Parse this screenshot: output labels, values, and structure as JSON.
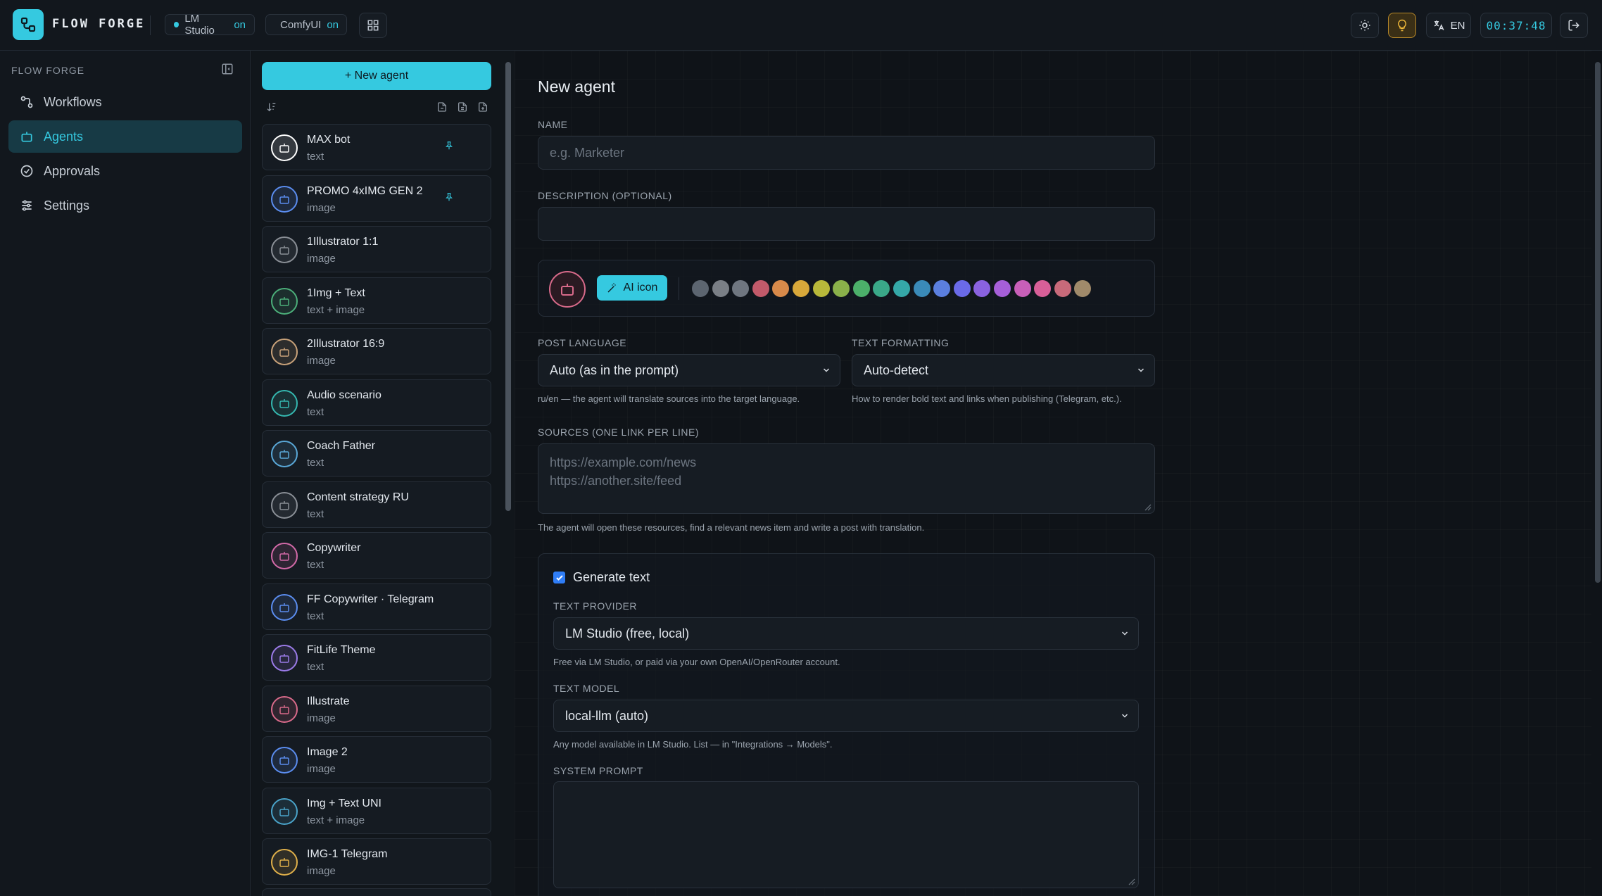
{
  "header": {
    "brand": "FLOW FORGE",
    "status": [
      {
        "name": "LM Studio",
        "state": "on"
      },
      {
        "name": "ComfyUI",
        "state": "on"
      }
    ],
    "language": "EN",
    "timer": "00:37:48"
  },
  "sidebar": {
    "title": "FLOW FORGE",
    "items": [
      {
        "label": "Workflows",
        "icon": "workflow-icon"
      },
      {
        "label": "Agents",
        "icon": "bot-icon",
        "active": true
      },
      {
        "label": "Approvals",
        "icon": "check-circle-icon"
      },
      {
        "label": "Settings",
        "icon": "sliders-icon"
      }
    ]
  },
  "agents": {
    "new_label": "+ New agent",
    "list": [
      {
        "name": "MAX bot",
        "type": "text",
        "color": "#ffffff",
        "pinned": true
      },
      {
        "name": "PROMO 4xIMG GEN 2",
        "type": "image",
        "color": "#5b8def",
        "pinned": true
      },
      {
        "name": "1Illustrator 1:1",
        "type": "image",
        "color": "#8a8f96"
      },
      {
        "name": "1Img + Text",
        "type": "text + image",
        "color": "#4caf7a"
      },
      {
        "name": "2Illustrator 16:9",
        "type": "image",
        "color": "#c9a27a"
      },
      {
        "name": "Audio scenario",
        "type": "text",
        "color": "#35b8b0"
      },
      {
        "name": "Coach Father",
        "type": "text",
        "color": "#5aa8d8"
      },
      {
        "name": "Content strategy RU",
        "type": "text",
        "color": "#8a8f96"
      },
      {
        "name": "Copywriter",
        "type": "text",
        "color": "#d36aa8"
      },
      {
        "name": "FF Copywriter · Telegram",
        "type": "text",
        "color": "#5b8def"
      },
      {
        "name": "FitLife Theme",
        "type": "text",
        "color": "#9b7be8"
      },
      {
        "name": "Illustrate",
        "type": "image",
        "color": "#d86a8a"
      },
      {
        "name": "Image 2",
        "type": "image",
        "color": "#5b8def"
      },
      {
        "name": "Img + Text UNI",
        "type": "text + image",
        "color": "#4aa3c9"
      },
      {
        "name": "IMG-1 Telegram",
        "type": "image",
        "color": "#e0b04a"
      }
    ]
  },
  "form": {
    "title": "New agent",
    "name_label": "NAME",
    "name_placeholder": "e.g. Marketer",
    "desc_label": "DESCRIPTION (OPTIONAL)",
    "ai_icon_label": "AI icon",
    "swatches": [
      "#5c6570",
      "#7a7f86",
      "#6f7680",
      "#c25a6a",
      "#d88a4a",
      "#d8a83a",
      "#b8b83a",
      "#8ab04a",
      "#4caf6a",
      "#3aa888",
      "#35a8a8",
      "#3a8ab8",
      "#5b7fdf",
      "#6a6ae8",
      "#8a62e0",
      "#a65fd8",
      "#c85fb8",
      "#d85f98",
      "#c86a7a",
      "#a08a6a"
    ],
    "post_language_label": "POST LANGUAGE",
    "post_language_value": "Auto (as in the prompt)",
    "post_language_hint": "ru/en — the agent will translate sources into the target language.",
    "formatting_label": "TEXT FORMATTING",
    "formatting_value": "Auto-detect",
    "formatting_hint": "How to render bold text and links when publishing (Telegram, etc.).",
    "sources_label": "SOURCES (ONE LINK PER LINE)",
    "sources_placeholder_1": "https://example.com/news",
    "sources_placeholder_2": "https://another.site/feed",
    "sources_hint": "The agent will open these resources, find a relevant news item and write a post with translation.",
    "generate_text_label": "Generate text",
    "text_provider_label": "TEXT PROVIDER",
    "text_provider_value": "LM Studio (free, local)",
    "text_provider_hint": "Free via LM Studio, or paid via your own OpenAI/OpenRouter account.",
    "text_model_label": "TEXT MODEL",
    "text_model_value": "local-llm (auto)",
    "text_model_hint": "Any model available in LM Studio. List — in \"Integrations → Models\".",
    "system_prompt_label": "SYSTEM PROMPT"
  }
}
